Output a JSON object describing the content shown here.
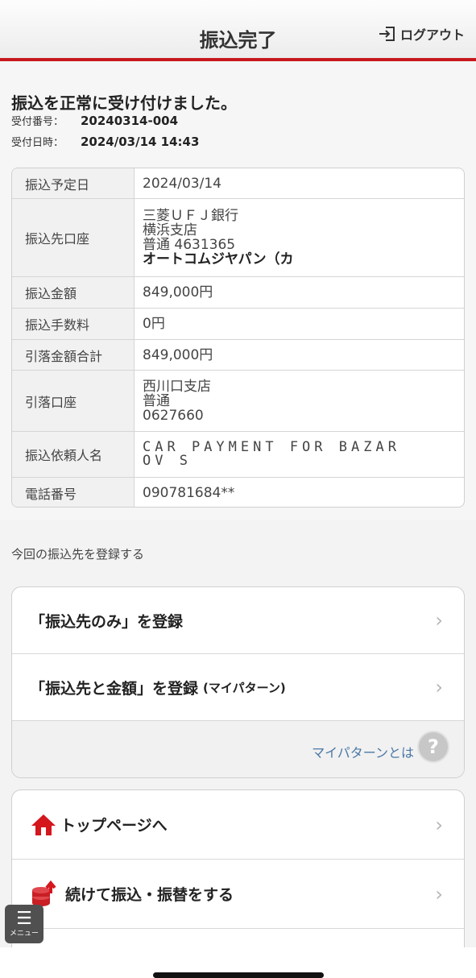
{
  "header": {
    "title": "振込完了",
    "logout_label": "ログアウト"
  },
  "message": "振込を正常に受け付けました。",
  "receipt": {
    "number_label": "受付番号：",
    "number": "20240314-004",
    "datetime_label": "受付日時：",
    "datetime": "2024/03/14 14:43"
  },
  "details": [
    {
      "label": "振込予定日",
      "lines": [
        "2024/03/14"
      ]
    },
    {
      "label": "振込先口座",
      "lines": [
        "三菱ＵＦＪ銀行",
        "横浜支店",
        "普通 4631365"
      ],
      "bold_line": "オートコムジヤパン（カ"
    },
    {
      "label": "振込金額",
      "lines": [
        "849,000円"
      ]
    },
    {
      "label": "振込手数料",
      "lines": [
        "0円"
      ]
    },
    {
      "label": "引落金額合計",
      "lines": [
        "849,000円"
      ]
    },
    {
      "label": "引落口座",
      "lines": [
        "西川口支店",
        "普通",
        "0627660"
      ]
    },
    {
      "label": "振込依頼人名",
      "lines": [
        "CAR PAYMENT FOR BAZAR",
        "OV S"
      ]
    },
    {
      "label": "電話番号",
      "lines": [
        "090781684**"
      ]
    }
  ],
  "register": {
    "section_label": "今回の振込先を登録する",
    "payee_only": "「振込先のみ」を登録",
    "payee_amount": "「振込先と金額」を登録",
    "payee_amount_sub": "(マイパターン)",
    "help_link": "マイパターンとは",
    "help_icon": "?"
  },
  "nav": {
    "top_page": "トップページへ",
    "continue_transfer": "続けて振込・振替をする"
  },
  "menu": {
    "icon": "☰",
    "label": "メニュー"
  },
  "colors": {
    "accent": "#c8171e",
    "link": "#4a78a6"
  }
}
